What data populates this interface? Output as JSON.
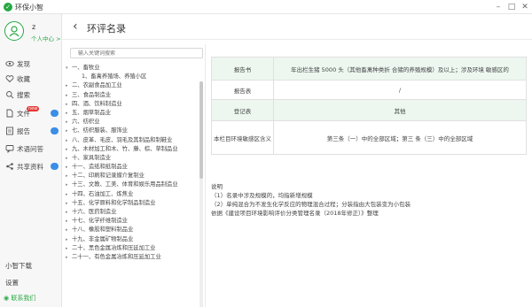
{
  "window": {
    "title": "环保小智",
    "logo_char": "✓",
    "min_icon": "minimize-icon",
    "max_icon": "maximize-icon",
    "close_icon": "close-icon"
  },
  "user": {
    "name": "z",
    "center_label": "个人中心 >"
  },
  "nav": [
    {
      "label": "发现",
      "icon": "eye-icon"
    },
    {
      "label": "收藏",
      "icon": "heart-icon"
    },
    {
      "label": "搜索",
      "icon": "search-icon"
    },
    {
      "label": "文件",
      "icon": "file-icon",
      "badge": "new"
    },
    {
      "label": "报告",
      "icon": "report-icon"
    },
    {
      "label": "术语问答",
      "icon": "qa-icon"
    },
    {
      "label": "共享资料",
      "icon": "share-icon"
    }
  ],
  "sidebar_bottom": {
    "download": "小智下载",
    "settings": "设置",
    "contact": "联系我们"
  },
  "page": {
    "title": "环评名录"
  },
  "search": {
    "placeholder": "输入关键词搜索"
  },
  "tree": [
    {
      "label": "一、畜牧业",
      "expanded": true,
      "children": [
        "1、畜禽养殖场、养殖小区"
      ]
    },
    {
      "label": "二、农副食品加工业"
    },
    {
      "label": "三、食品制造业"
    },
    {
      "label": "四、酒、饮料制造业"
    },
    {
      "label": "五、烟草制品业"
    },
    {
      "label": "六、纺织业"
    },
    {
      "label": "七、纺织服装、服饰业"
    },
    {
      "label": "八、皮革、毛皮、羽毛及其制品和制鞋业"
    },
    {
      "label": "九、木材加工和木、竹、藤、棕、草制品业"
    },
    {
      "label": "十、家具制造业"
    },
    {
      "label": "十一、造纸和纸制品业"
    },
    {
      "label": "十二、印刷和记录媒介复制业"
    },
    {
      "label": "十三、文教、工美、体育和娱乐用品制造业"
    },
    {
      "label": "十四、石油加工、炼焦业"
    },
    {
      "label": "十五、化学原料和化学制品制造业"
    },
    {
      "label": "十六、医药制造业"
    },
    {
      "label": "十七、化学纤维制造业"
    },
    {
      "label": "十八、橡胶和塑料制品业"
    },
    {
      "label": "十九、非金属矿物制品业"
    },
    {
      "label": "二十、黑色金属冶炼和压延加工业"
    },
    {
      "label": "二十一、有色金属冶炼和压延加工业"
    }
  ],
  "table": [
    {
      "label": "报告书",
      "value": "年出栏生猪 5000 头（其他畜禽种类折 合猪的养殖规模）及以上；涉及环境 敏感区的"
    },
    {
      "label": "报告表",
      "value": "/"
    },
    {
      "label": "登记表",
      "value": "其他"
    },
    {
      "label": "本栏目环境敏感区含义",
      "value": "第三条（一）中的全部区域；第三 条（三）中的全部区域"
    }
  ],
  "notes": {
    "heading": "说明",
    "line1": "（1）名录中涉及规模的，均指新增规模",
    "line2": "（2）单纯混合为不发生化学反应的物理混合过程；分装指由大包装变为小包装",
    "line3": "依据《建设项目环境影响评价分类管理名录（2018年修正）》整理"
  },
  "colors": {
    "accent": "#27a844",
    "link": "#3a8ee6",
    "badge": "#e53935",
    "row_shade": "#edf7f0"
  }
}
